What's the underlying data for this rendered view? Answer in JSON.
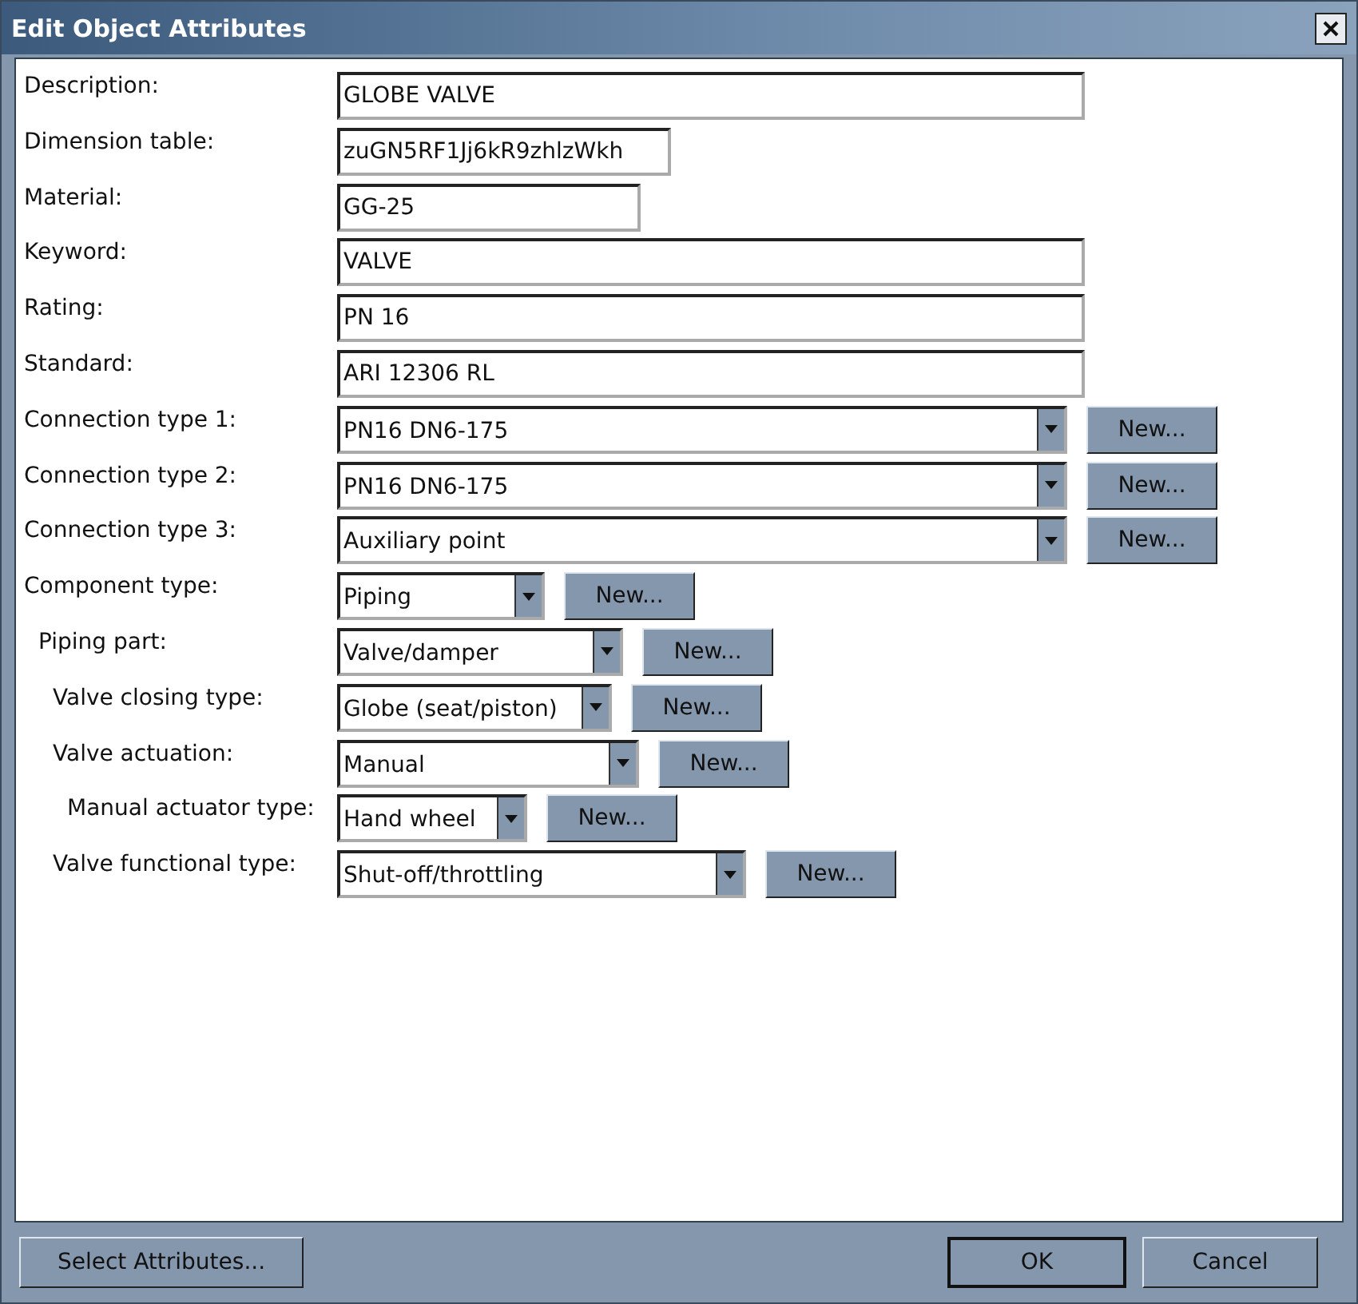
{
  "window": {
    "title": "Edit Object Attributes"
  },
  "fields": [
    {
      "kind": "text",
      "label": "Description:",
      "value": "GLOBE VALVE"
    },
    {
      "kind": "text",
      "label": "Dimension table:",
      "value": "zuGN5RF1Jj6kR9zhlzWkh"
    },
    {
      "kind": "text",
      "label": "Material:",
      "value": "GG-25"
    },
    {
      "kind": "text",
      "label": "Keyword:",
      "value": "VALVE"
    },
    {
      "kind": "text",
      "label": "Rating:",
      "value": "PN 16"
    },
    {
      "kind": "text",
      "label": "Standard:",
      "value": "ARI 12306 RL"
    },
    {
      "kind": "combo",
      "label": "Connection type 1:",
      "value": "PN16 DN6-175",
      "button": "New..."
    },
    {
      "kind": "combo",
      "label": "Connection type 2:",
      "value": "PN16 DN6-175",
      "button": "New..."
    },
    {
      "kind": "combo",
      "label": "Connection type 3:",
      "value": "Auxiliary point",
      "button": "New..."
    },
    {
      "kind": "combo",
      "label": "Component type:",
      "value": "Piping",
      "button": "New...",
      "children": [
        {
          "kind": "combo",
          "label": "Piping part:",
          "value": "Valve/damper",
          "button": "New...",
          "children": [
            {
              "kind": "combo",
              "label": "Valve closing type:",
              "value": "Globe (seat/piston)",
              "button": "New..."
            },
            {
              "kind": "combo",
              "label": "Valve actuation:",
              "value": "Manual",
              "button": "New...",
              "children": [
                {
                  "kind": "combo",
                  "label": "Manual actuator type:",
                  "value": "Hand wheel",
                  "button": "New..."
                }
              ]
            },
            {
              "kind": "combo",
              "label": "Valve functional type:",
              "value": "Shut-off/throttling",
              "button": "New..."
            }
          ]
        }
      ]
    }
  ],
  "footer": {
    "select_button": "Select Attributes...",
    "ok_button": "OK",
    "cancel_button": "Cancel"
  }
}
